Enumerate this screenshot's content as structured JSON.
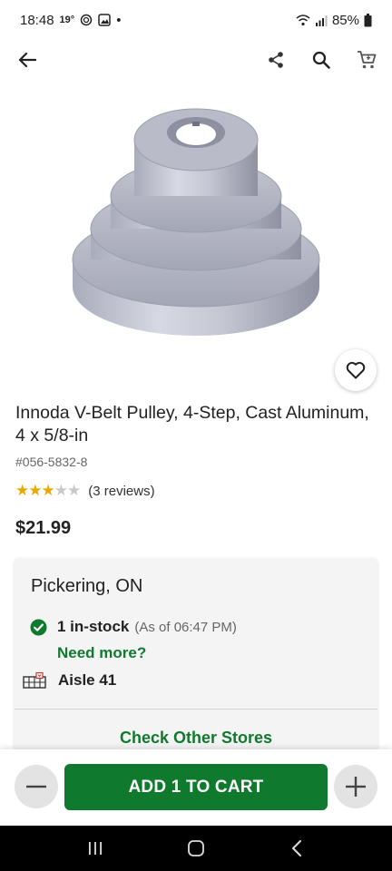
{
  "status_bar": {
    "time": "18:48",
    "temperature": "19°",
    "dot": "•",
    "battery": "85%",
    "icons": [
      "weather-icon",
      "image-icon",
      "wifi-icon",
      "signal-icon",
      "battery-icon"
    ]
  },
  "app_bar": {
    "icons": [
      "back-arrow-icon",
      "share-icon",
      "search-icon",
      "cart-icon"
    ]
  },
  "product": {
    "title": "Innoda V-Belt Pulley, 4-Step, Cast Aluminum, 4 x 5/8-in",
    "sku": "#056-5832-8",
    "rating": 3,
    "rating_max": 5,
    "reviews": "(3 reviews)",
    "price": "$21.99"
  },
  "store": {
    "name": "Pickering, ON",
    "stock_count": "1 in-stock",
    "stock_asof": "(As of 06:47 PM)",
    "need_more": "Need more?",
    "aisle": "Aisle 41",
    "check_other": "Check Other Stores"
  },
  "cart_bar": {
    "add_label": "ADD 1 TO CART",
    "quantity": 1
  },
  "colors": {
    "accent_green": "#0f7a2e",
    "star": "#e9a800"
  }
}
